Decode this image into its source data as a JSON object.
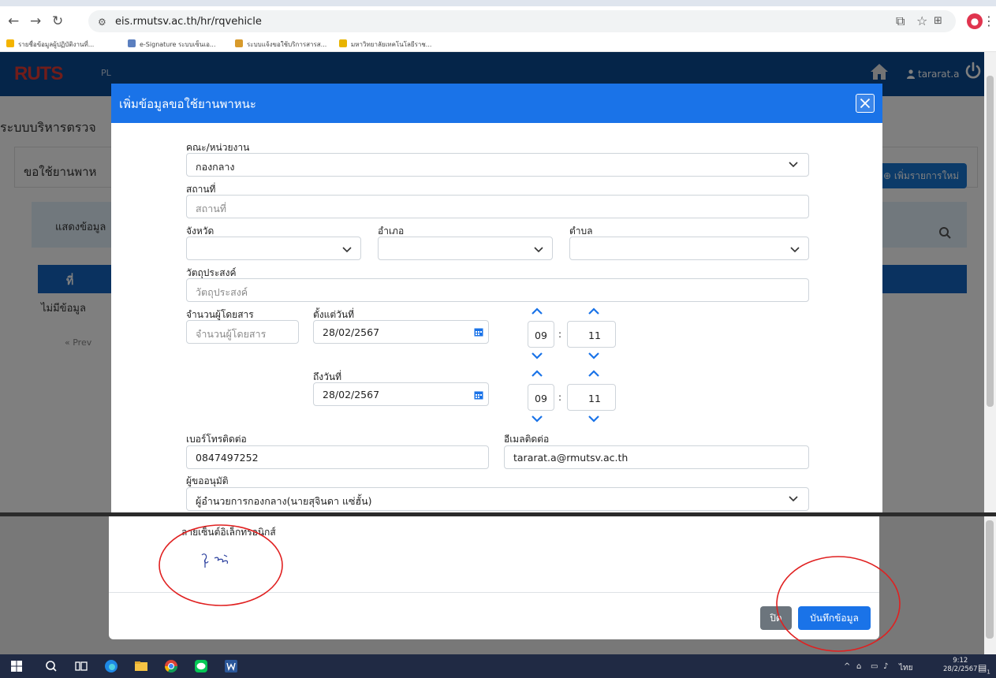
{
  "browser": {
    "url": "eis.rmutsv.ac.th/hr/rqvehicle",
    "bookmarks": [
      {
        "label": "รายชื่อข้อมูลผู้ปฏิบัติงานที่...",
        "icon": "drive-icon",
        "color": "#f4b400"
      },
      {
        "label": "e-Signature ระบบเซ็นเอ...",
        "icon": "esign-icon",
        "color": "#5b7fbf"
      },
      {
        "label": "ระบบแจ้งขอใช้บริการสารส...",
        "icon": "bell-icon",
        "color": "#d89a2b"
      },
      {
        "label": "มหาวิทยาลัยเทคโนโลยีราช...",
        "icon": "star-icon",
        "color": "#e8b400"
      }
    ]
  },
  "app": {
    "logo": "RUTS",
    "nav_fragment": "PL",
    "user_name": "tararat.a",
    "page_title": "ระบบบริหารตรวจ",
    "card_title": "ขอใช้ยานพาห",
    "add_button": "เพิ่มรายการใหม่",
    "filter_label": "แสดงข้อมูล",
    "table_header_no": "ที่",
    "no_data": "ไม่มีข้อมูล",
    "prev": "« Prev"
  },
  "modal": {
    "title": "เพิ่มข้อมูลขอใช้ยานพาหนะ",
    "fields": {
      "department": {
        "label": "คณะ/หน่วยงาน",
        "value": "กองกลาง"
      },
      "place": {
        "label": "สถานที่",
        "placeholder": "สถานที่"
      },
      "province": {
        "label": "จังหวัด",
        "value": ""
      },
      "district": {
        "label": "อำเภอ",
        "value": ""
      },
      "subdistrict": {
        "label": "ตำบล",
        "value": ""
      },
      "purpose": {
        "label": "วัตถุประสงค์",
        "placeholder": "วัตถุประสงค์"
      },
      "passengers": {
        "label": "จำนวนผู้โดยสาร",
        "placeholder": "จำนวนผู้โดยสาร"
      },
      "from_date": {
        "label": "ตั้งแต่วันที่",
        "value": "28/02/2567",
        "hour": "09",
        "minute": "11"
      },
      "to_date": {
        "label": "ถึงวันที่",
        "value": "28/02/2567",
        "hour": "09",
        "minute": "11"
      },
      "phone": {
        "label": "เบอร์โทรติดต่อ",
        "value": "0847497252"
      },
      "email": {
        "label": "อีเมลติดต่อ",
        "value": "tararat.a@rmutsv.ac.th"
      },
      "approver": {
        "label": "ผู้ขออนุมัติ",
        "value": "ผู้อำนวยการกองกลาง(นายสุจินดา แซ่ฮั้น)"
      }
    },
    "time_separator": ":",
    "signature_label": "ลายเซ็นต์อิเล็กทรอนิกส์",
    "close_button": "ปิด",
    "save_button": "บันทึกข้อมูล"
  },
  "annotation_color": "#e02020",
  "taskbar": {
    "apps": [
      "windows-icon",
      "search-icon",
      "task-view-icon",
      "edge-icon",
      "file-explorer-icon",
      "chrome-icon",
      "line-icon",
      "word-icon"
    ],
    "language": "ไทย",
    "time": "9:12",
    "date": "28/2/2567",
    "notification_count": "1"
  }
}
